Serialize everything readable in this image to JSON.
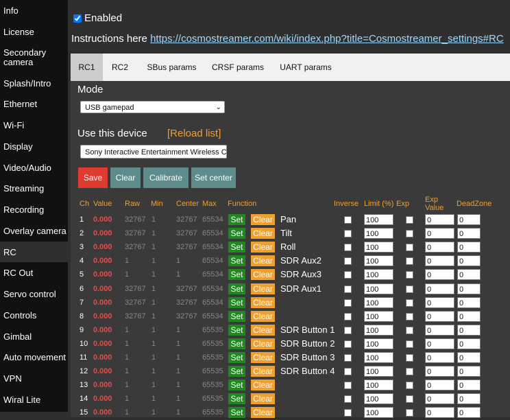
{
  "sidebar": {
    "items": [
      {
        "label": "Info",
        "name": "info"
      },
      {
        "label": "License",
        "name": "license"
      },
      {
        "label": "Secondary camera",
        "name": "secondary-camera"
      },
      {
        "label": "Splash/Intro",
        "name": "splash-intro"
      },
      {
        "label": "Ethernet",
        "name": "ethernet"
      },
      {
        "label": "Wi-Fi",
        "name": "wifi"
      },
      {
        "label": "Display",
        "name": "display"
      },
      {
        "label": "Video/Audio",
        "name": "video-audio"
      },
      {
        "label": "Streaming",
        "name": "streaming"
      },
      {
        "label": "Recording",
        "name": "recording"
      },
      {
        "label": "Overlay camera",
        "name": "overlay-camera"
      },
      {
        "label": "RC",
        "name": "rc"
      },
      {
        "label": "RC Out",
        "name": "rc-out"
      },
      {
        "label": "Servo control",
        "name": "servo-control"
      },
      {
        "label": "Controls",
        "name": "controls"
      },
      {
        "label": "Gimbal",
        "name": "gimbal"
      },
      {
        "label": "Auto movement",
        "name": "auto-movement"
      },
      {
        "label": "VPN",
        "name": "vpn"
      },
      {
        "label": "Wiral Lite",
        "name": "wiral-lite"
      }
    ]
  },
  "enabled_label": "Enabled",
  "instructions_text": "Instructions here",
  "instructions_link": "https://cosmostreamer.com/wiki/index.php?title=Cosmostreamer_settings#RC",
  "tabs": [
    {
      "label": "RC1",
      "name": "rc1"
    },
    {
      "label": "RC2",
      "name": "rc2"
    },
    {
      "label": "SBus params",
      "name": "sbus-params"
    },
    {
      "label": "CRSF params",
      "name": "crsf-params"
    },
    {
      "label": "UART params",
      "name": "uart-params"
    }
  ],
  "mode_label": "Mode",
  "mode_value": "USB gamepad",
  "device_label": "Use this device",
  "reload_label": "[Reload list]",
  "device_value": "Sony Interactive Entertainment Wireless Con",
  "buttons": {
    "save": "Save",
    "clear": "Clear",
    "calibrate": "Calibrate",
    "set_center": "Set center"
  },
  "headers": {
    "ch": "Ch",
    "value": "Value",
    "raw": "Raw",
    "min": "Min",
    "center": "Center",
    "max": "Max",
    "function": "Function",
    "inverse": "Inverse",
    "limit": "Limit (%)",
    "exp": "Exp",
    "exp_value": "Exp Value",
    "deadzone": "DeadZone"
  },
  "row_set": "Set",
  "row_clear": "Clear",
  "rows": [
    {
      "ch": "1",
      "value": "0.000",
      "raw": "32767",
      "min": "1",
      "center": "32767",
      "max": "65534",
      "func": "Pan",
      "limit": "100",
      "exp_value": "0",
      "deadzone": "0"
    },
    {
      "ch": "2",
      "value": "0.000",
      "raw": "32767",
      "min": "1",
      "center": "32767",
      "max": "65534",
      "func": "Tilt",
      "limit": "100",
      "exp_value": "0",
      "deadzone": "0"
    },
    {
      "ch": "3",
      "value": "0.000",
      "raw": "32767",
      "min": "1",
      "center": "32767",
      "max": "65534",
      "func": "Roll",
      "limit": "100",
      "exp_value": "0",
      "deadzone": "0"
    },
    {
      "ch": "4",
      "value": "0.000",
      "raw": "1",
      "min": "1",
      "center": "1",
      "max": "65534",
      "func": "SDR Aux2",
      "limit": "100",
      "exp_value": "0",
      "deadzone": "0"
    },
    {
      "ch": "5",
      "value": "0.000",
      "raw": "1",
      "min": "1",
      "center": "1",
      "max": "65534",
      "func": "SDR Aux3",
      "limit": "100",
      "exp_value": "0",
      "deadzone": "0"
    },
    {
      "ch": "6",
      "value": "0.000",
      "raw": "32767",
      "min": "1",
      "center": "32767",
      "max": "65534",
      "func": "SDR Aux1",
      "limit": "100",
      "exp_value": "0",
      "deadzone": "0"
    },
    {
      "ch": "7",
      "value": "0.000",
      "raw": "32767",
      "min": "1",
      "center": "32767",
      "max": "65534",
      "func": "",
      "limit": "100",
      "exp_value": "0",
      "deadzone": "0"
    },
    {
      "ch": "8",
      "value": "0.000",
      "raw": "32767",
      "min": "1",
      "center": "32767",
      "max": "65534",
      "func": "",
      "limit": "100",
      "exp_value": "0",
      "deadzone": "0"
    },
    {
      "ch": "9",
      "value": "0.000",
      "raw": "1",
      "min": "1",
      "center": "1",
      "max": "65535",
      "func": "SDR Button 1",
      "limit": "100",
      "exp_value": "0",
      "deadzone": "0"
    },
    {
      "ch": "10",
      "value": "0.000",
      "raw": "1",
      "min": "1",
      "center": "1",
      "max": "65535",
      "func": "SDR Button 2",
      "limit": "100",
      "exp_value": "0",
      "deadzone": "0"
    },
    {
      "ch": "11",
      "value": "0.000",
      "raw": "1",
      "min": "1",
      "center": "1",
      "max": "65535",
      "func": "SDR Button 3",
      "limit": "100",
      "exp_value": "0",
      "deadzone": "0"
    },
    {
      "ch": "12",
      "value": "0.000",
      "raw": "1",
      "min": "1",
      "center": "1",
      "max": "65535",
      "func": "SDR Button 4",
      "limit": "100",
      "exp_value": "0",
      "deadzone": "0"
    },
    {
      "ch": "13",
      "value": "0.000",
      "raw": "1",
      "min": "1",
      "center": "1",
      "max": "65535",
      "func": "",
      "limit": "100",
      "exp_value": "0",
      "deadzone": "0"
    },
    {
      "ch": "14",
      "value": "0.000",
      "raw": "1",
      "min": "1",
      "center": "1",
      "max": "65535",
      "func": "",
      "limit": "100",
      "exp_value": "0",
      "deadzone": "0"
    },
    {
      "ch": "15",
      "value": "0.000",
      "raw": "1",
      "min": "1",
      "center": "1",
      "max": "65535",
      "func": "",
      "limit": "100",
      "exp_value": "0",
      "deadzone": "0"
    }
  ]
}
